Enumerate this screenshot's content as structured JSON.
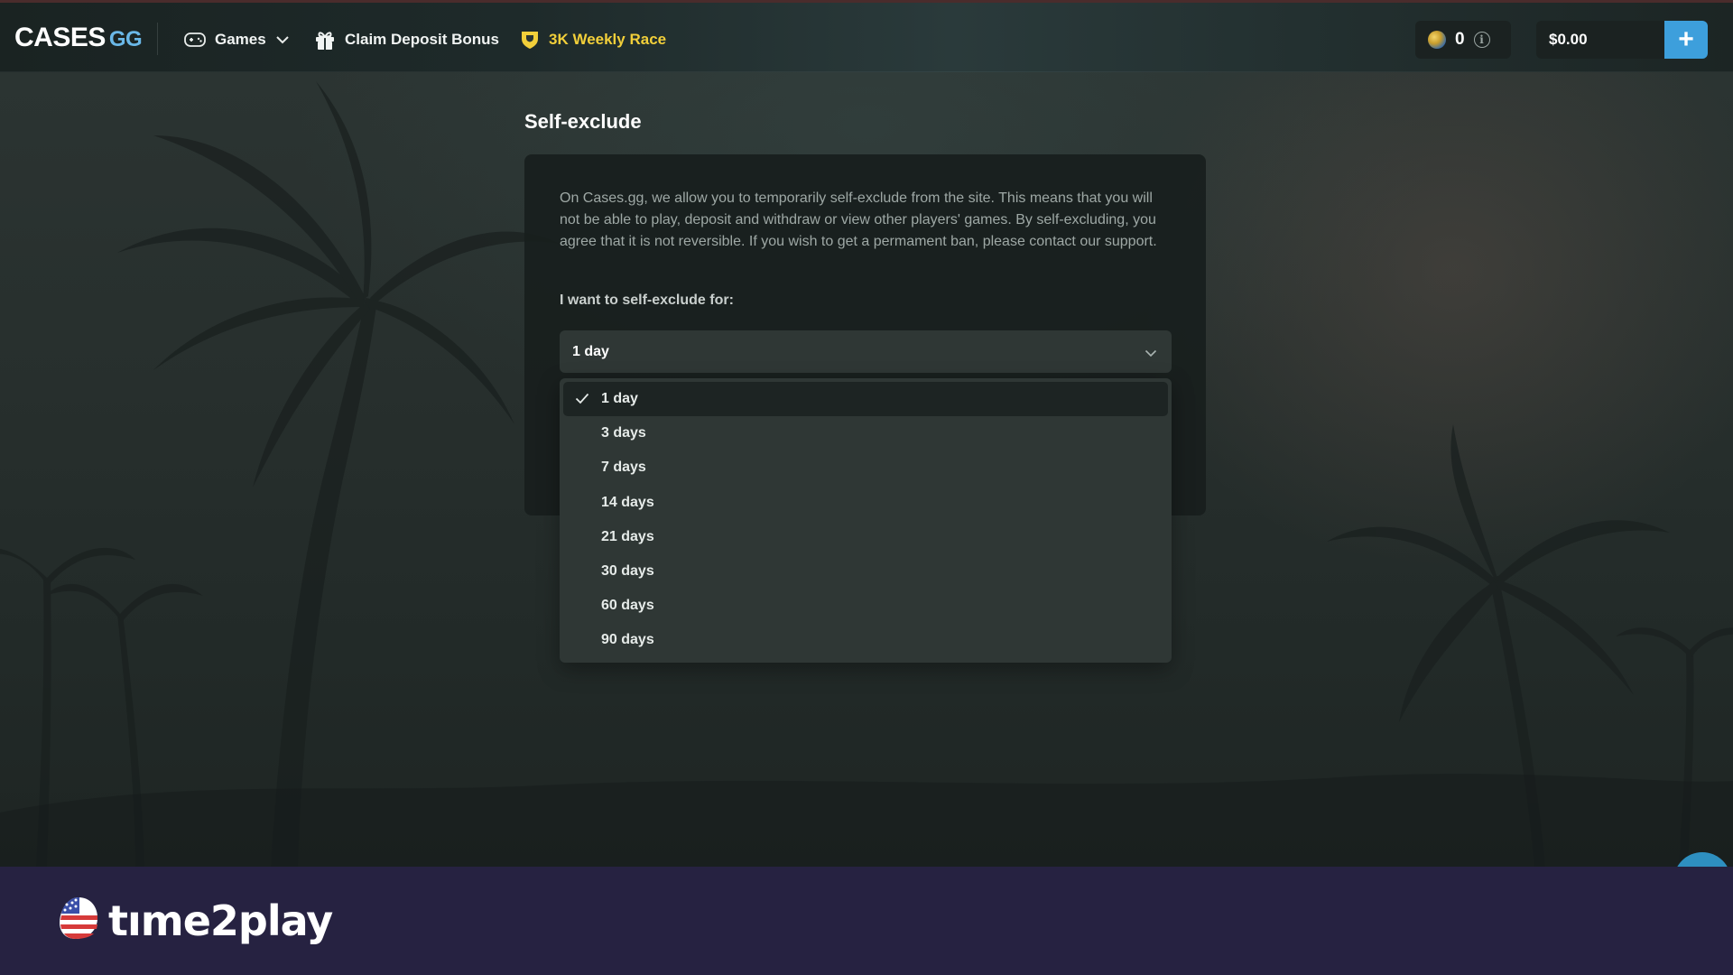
{
  "header": {
    "logo_main": "CASES",
    "logo_suffix": "GG",
    "nav": {
      "games_label": "Games",
      "bonus_label": "Claim Deposit Bonus",
      "race_label": "3K Weekly Race"
    },
    "coins": "0",
    "balance": "$0.00",
    "deposit_symbol": "+"
  },
  "page": {
    "title": "Self-exclude",
    "description": "On Cases.gg, we allow you to temporarily self-exclude from the site. This means that you will not be able to play, deposit and withdraw or view other players' games. By self-excluding, you agree that it is not reversible. If you wish to get a permament ban, please contact our support.",
    "field_label": "I want to self-exclude for:",
    "selected_value": "1 day",
    "options": [
      "1 day",
      "3 days",
      "7 days",
      "14 days",
      "21 days",
      "30 days",
      "60 days",
      "90 days"
    ]
  },
  "banner": {
    "brand": "tıme2play"
  },
  "colors": {
    "accent_blue": "#3d9fdc",
    "race_yellow": "#f2cf3a",
    "banner_bg": "#262241"
  },
  "icons": {
    "games": "gamepad-icon",
    "bonus": "gift-icon",
    "race": "trophy-shield-icon",
    "coin": "coin-icon",
    "info": "info-icon",
    "dropdown": "chevron-down-icon",
    "selected": "check-icon"
  }
}
